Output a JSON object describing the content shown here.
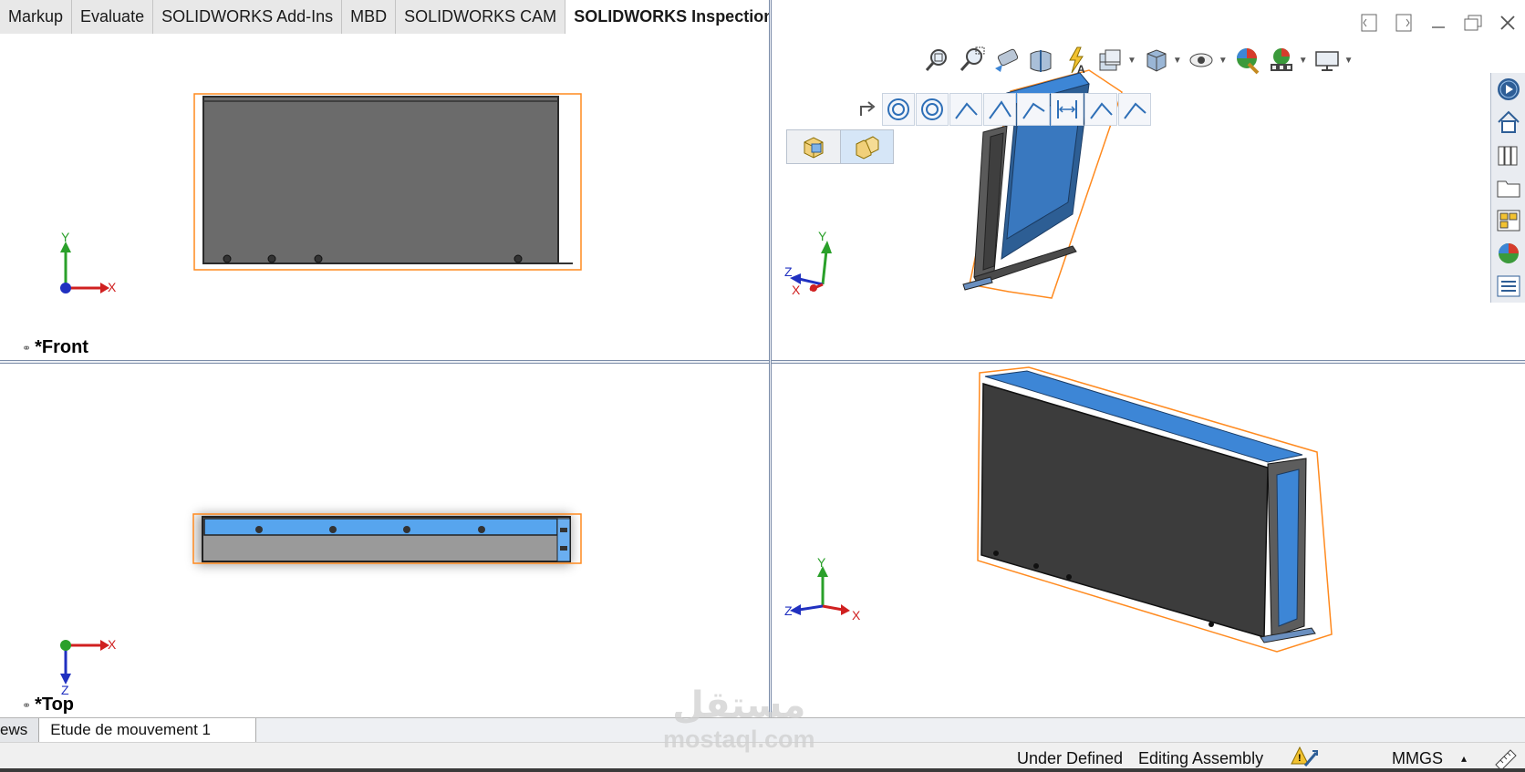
{
  "ribbon": {
    "tabs": [
      {
        "label": "Markup",
        "active": false
      },
      {
        "label": "Evaluate",
        "active": false
      },
      {
        "label": "SOLIDWORKS Add-Ins",
        "active": false
      },
      {
        "label": "MBD",
        "active": false
      },
      {
        "label": "SOLIDWORKS CAM",
        "active": false
      },
      {
        "label": "SOLIDWORKS Inspection",
        "active": true
      }
    ]
  },
  "viewports": {
    "front": {
      "label": "*Front"
    },
    "top": {
      "label": "*Top"
    }
  },
  "triad": {
    "x": "X",
    "y": "Y",
    "z": "Z"
  },
  "heads_up_toolbar": {
    "icons": [
      "zoom-to-fit-icon",
      "zoom-to-area-icon",
      "previous-view-icon",
      "section-view-icon",
      "dynamic-annotation-icon",
      "view-orientation-icon",
      "display-style-icon",
      "hide-show-items-icon",
      "edit-appearance-icon",
      "apply-scene-icon",
      "view-settings-icon"
    ]
  },
  "sketch_toolbar": {
    "icons": [
      "circle-icon",
      "circle-icon",
      "line-icon",
      "line-icon",
      "line-icon",
      "smart-dimension-icon",
      "line-icon",
      "line-icon"
    ]
  },
  "task_pane": {
    "icons": [
      "solidworks-resources-icon",
      "home-icon",
      "design-library-icon",
      "file-explorer-icon",
      "view-palette-icon",
      "appearances-icon",
      "custom-properties-icon"
    ]
  },
  "bottom_tabs": [
    {
      "label": "ews",
      "selected": false
    },
    {
      "label": "Etude de mouvement 1",
      "selected": true
    }
  ],
  "status_bar": {
    "definition": "Under Defined",
    "mode": "Editing Assembly",
    "units": "MMGS",
    "caret": "▴"
  },
  "watermark": {
    "arabic": "مستقل",
    "latin": "mostaql.com"
  },
  "colors": {
    "part_gray": "#6b6b6b",
    "face_blue": "#3d86d6",
    "bbox_orange": "#ff8a1f",
    "accent_blue": "#2e5e96"
  }
}
